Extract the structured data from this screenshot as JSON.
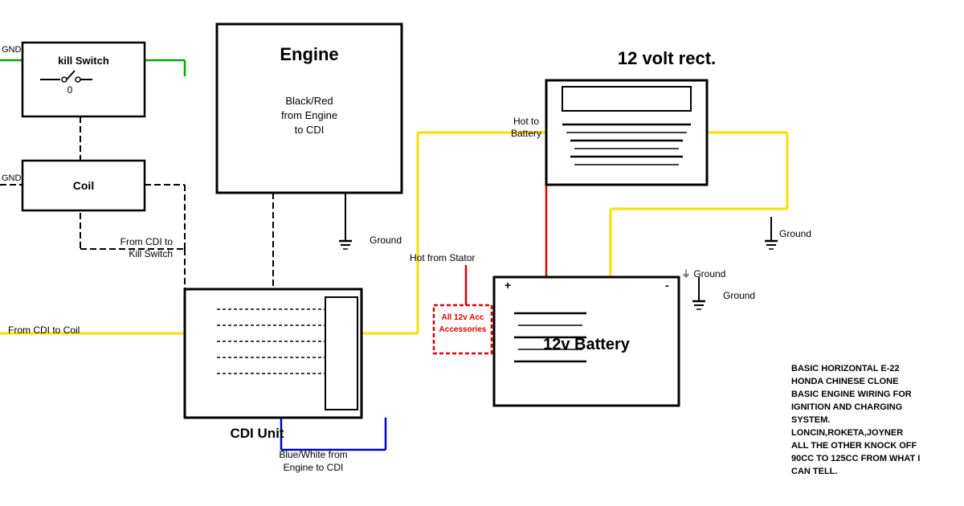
{
  "title": "Basic Horizontal E-22 Honda Chinese Clone Basic Engine Wiring",
  "components": {
    "kill_switch": "kill Switch",
    "coil": "Coil",
    "engine": "Engine",
    "cdi_unit": "CDI Unit",
    "battery": "12v Battery",
    "rectifier": "12 volt rect."
  },
  "labels": {
    "black_red": "Black/Red\nfrom Engine\nto CDI",
    "from_cdi_kill": "From CDI to\nKill Switch",
    "ground1": "Ground",
    "hot_from_stator": "Hot from Stator",
    "hot_to_battery": "Hot to\nBattery",
    "ground2": "Ground",
    "ground3": "Ground",
    "from_cdi_coil": "From CDI to Coil",
    "blue_white": "Blue/White from\nEngine to CDI",
    "all_12v": "All 12v Acc\nAccessories"
  },
  "info_text": [
    "BASIC HORIZONTAL E-22",
    "HONDA CHINESE CLONE",
    "BASIC ENGINE WIRING FOR",
    "IGNITION AND CHARGING",
    "SYSTEM.",
    "LONCIN,ROKETA,JOYNER",
    "ALL THE OTHER KNOCK OFF",
    "90CC TO 125CC FROM WHAT I",
    "CAN TELL."
  ],
  "colors": {
    "green": "#00aa00",
    "yellow": "#ffdd00",
    "red": "#dd0000",
    "blue": "#0000dd",
    "black": "#000000",
    "white": "#ffffff"
  }
}
